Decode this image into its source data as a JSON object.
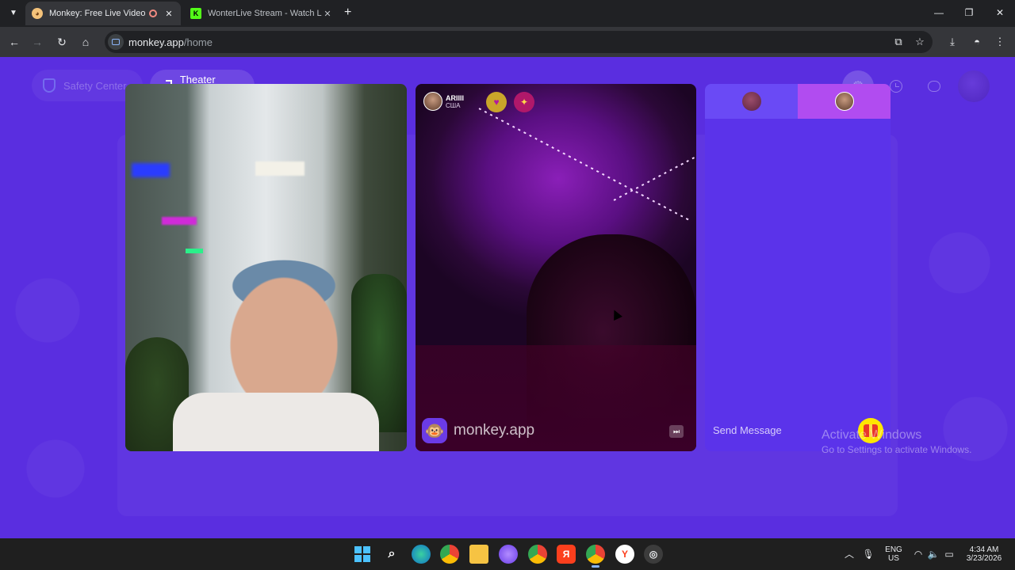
{
  "browser": {
    "tabs": [
      {
        "title": "Monkey: Free Live Video Chat",
        "active": true
      },
      {
        "title": "WonterLive Stream - Watch Live",
        "active": false
      }
    ],
    "url_host": "monkey.app",
    "url_path": "/home"
  },
  "header": {
    "safety_center_label": "Safety Center",
    "theater_mode_label": "Theater Mode"
  },
  "remote_user": {
    "name": "ARIIII",
    "country": "США"
  },
  "watermark": "monkey.app",
  "chat": {
    "placeholder": "Send Message"
  },
  "windows_watermark": {
    "line1": "Activate Windows",
    "line2": "Go to Settings to activate Windows."
  },
  "taskbar": {
    "lang_top": "ENG",
    "lang_bottom": "US",
    "time": "4:34 AM",
    "date": "3/23/2026"
  },
  "colors": {
    "page_bg": "#5a2ee0",
    "chat_tab_left": "#6a4af5",
    "chat_tab_right": "#b14cf0",
    "gift_button": "#ffe600"
  }
}
